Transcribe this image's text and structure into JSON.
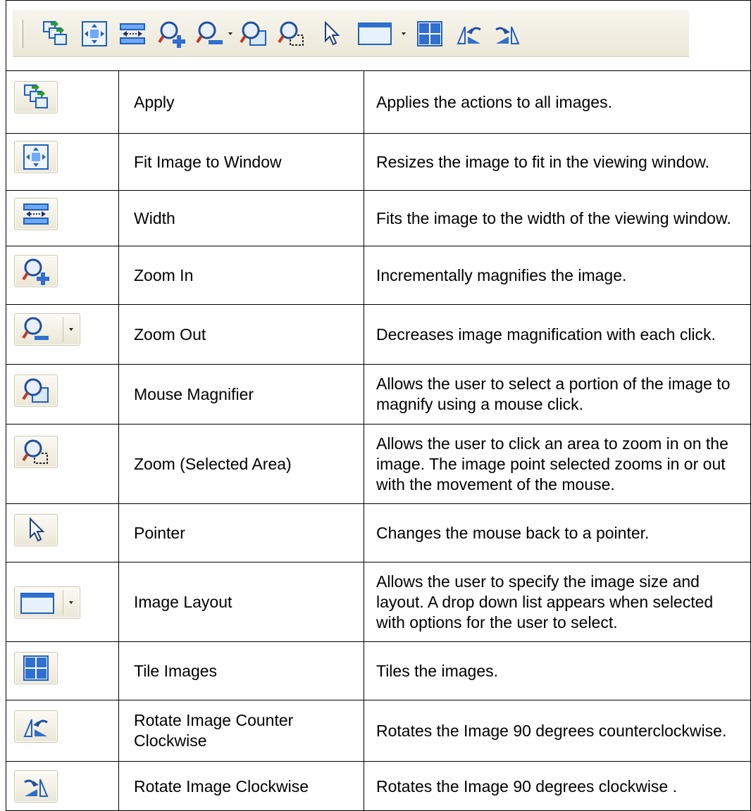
{
  "toolbar": {
    "icons": [
      "apply-icon",
      "fit-to-window-icon",
      "width-icon",
      "zoom-in-icon",
      "zoom-out-icon",
      "dropdown-arrow-icon",
      "mouse-magnifier-icon",
      "zoom-selected-area-icon",
      "pointer-icon",
      "image-layout-icon",
      "dropdown-arrow-icon",
      "tile-images-icon",
      "rotate-counterclockwise-icon",
      "rotate-clockwise-icon"
    ]
  },
  "rows": [
    {
      "icon": "apply-icon",
      "name": "Apply",
      "description": "Applies the actions to all images."
    },
    {
      "icon": "fit-to-window-icon",
      "name": "Fit Image to Window",
      "description": "Resizes the image to fit in the viewing window."
    },
    {
      "icon": "width-icon",
      "name": "Width",
      "description": "Fits the image to the width of the viewing window."
    },
    {
      "icon": "zoom-in-icon",
      "name": "Zoom In",
      "description": "Incrementally magnifies the image."
    },
    {
      "icon": "zoom-out-icon",
      "name": "Zoom Out",
      "description": "Decreases image magnification with each click."
    },
    {
      "icon": "mouse-magnifier-icon",
      "name": "Mouse Magnifier",
      "description": "Allows the user to select a portion of the image to magnify using a mouse click."
    },
    {
      "icon": "zoom-selected-area-icon",
      "name": "Zoom (Selected Area)",
      "description": "Allows the user to click an area to zoom in on the image. The image point selected zooms in or out with the movement of the mouse."
    },
    {
      "icon": "pointer-icon",
      "name": "Pointer",
      "description": "Changes the mouse back to a pointer."
    },
    {
      "icon": "image-layout-icon",
      "name": "Image Layout",
      "description": "Allows the user to specify the image size and layout. A drop down list appears when selected with options for the user to select."
    },
    {
      "icon": "tile-images-icon",
      "name": "Tile Images",
      "description": "Tiles the images."
    },
    {
      "icon": "rotate-counterclockwise-icon",
      "name": "Rotate Image Counter Clockwise",
      "description": "Rotates the Image 90 degrees counterclockwise."
    },
    {
      "icon": "rotate-clockwise-icon",
      "name": "Rotate Image Clockwise",
      "description": "Rotates the Image 90 degrees clockwise ."
    }
  ],
  "colors": {
    "border": "#000000",
    "toolbar_bg": "#ece8d8",
    "icon_blue": "#1f5fbf",
    "icon_green": "#2e9b2e"
  }
}
